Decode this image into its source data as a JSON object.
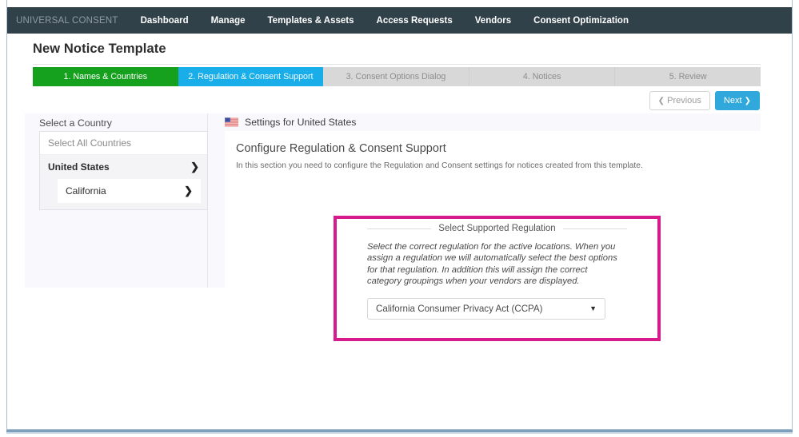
{
  "nav": {
    "brand": "UNIVERSAL CONSENT",
    "items": [
      {
        "label": "Dashboard"
      },
      {
        "label": "Manage"
      },
      {
        "label": "Templates & Assets"
      },
      {
        "label": "Access Requests"
      },
      {
        "label": "Vendors"
      },
      {
        "label": "Consent Optimization"
      }
    ]
  },
  "page": {
    "title": "New Notice Template"
  },
  "stepper": {
    "steps": [
      {
        "label": "1. Names & Countries",
        "state": "done"
      },
      {
        "label": "2. Regulation & Consent Support",
        "state": "active"
      },
      {
        "label": "3. Consent Options Dialog",
        "state": "todo"
      },
      {
        "label": "4. Notices",
        "state": "todo"
      },
      {
        "label": "5. Review",
        "state": "todo"
      }
    ]
  },
  "wizard_buttons": {
    "previous_label": "Previous",
    "previous_icon": "chevron-left-icon",
    "next_label": "Next",
    "next_icon": "chevron-right-icon"
  },
  "country_panel": {
    "label": "Select a Country",
    "rows": [
      {
        "label": "Select All Countries",
        "has_arrow": false,
        "level": 0
      },
      {
        "label": "United States",
        "has_arrow": true,
        "level": 0
      },
      {
        "label": "California",
        "has_arrow": true,
        "level": 1
      }
    ],
    "arrow_glyph": "❯"
  },
  "settings_header": {
    "flag_icon": "us-flag-icon",
    "label": "Settings for United States"
  },
  "main_panel": {
    "heading": "Configure Regulation & Consent Support",
    "subtext": "In this section you need to configure the Regulation and Consent settings for notices created from this template."
  },
  "regulation_fieldset": {
    "legend": "Select Supported Regulation",
    "description": "Select the correct regulation for the active locations. When you assign a regulation we will automatically select the best options for that regulation. In addition this will assign the correct category groupings when your vendors are displayed.",
    "select_value": "California Consumer Privacy Act (CCPA)",
    "select_caret_icon": "caret-down-icon"
  },
  "highlight": {
    "color": "#d81b8c"
  },
  "colors": {
    "nav_bg": "#31414a",
    "step_done": "#15a01e",
    "step_active": "#19aeea",
    "step_todo": "#d8d8d8",
    "next_button": "#30a8dc",
    "card_bg": "#f9f8fd"
  }
}
